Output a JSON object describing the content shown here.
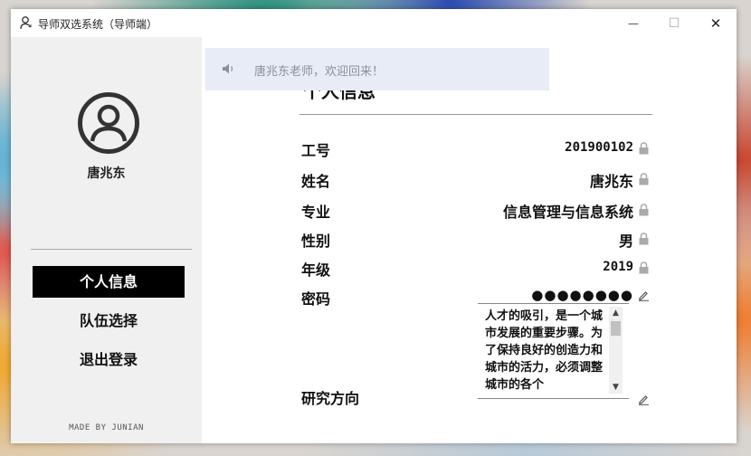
{
  "window": {
    "title": "导师双选系统（导师端）",
    "controls": {
      "minimize": "—",
      "maximize": "☐",
      "close": "✕"
    }
  },
  "sidebar": {
    "user_name": "唐兆东",
    "nav": [
      {
        "label": "个人信息",
        "active": true
      },
      {
        "label": "队伍选择",
        "active": false
      },
      {
        "label": "退出登录",
        "active": false
      }
    ],
    "credit": "MADE BY JUNIAN"
  },
  "notice": {
    "text": "唐兆东老师，欢迎回来！",
    "icon": "speaker-icon"
  },
  "profile": {
    "section_title": "个人信息",
    "rows": [
      {
        "label": "工号",
        "value": "201900102",
        "icon": "lock-icon"
      },
      {
        "label": "姓名",
        "value": "唐兆东",
        "icon": "lock-icon"
      },
      {
        "label": "专业",
        "value": "信息管理与信息系统",
        "icon": "lock-icon"
      },
      {
        "label": "性别",
        "value": "男",
        "icon": "lock-icon"
      },
      {
        "label": "年级",
        "value": "2019",
        "icon": "lock-icon"
      }
    ],
    "password": {
      "label": "密码",
      "value": "●●●●●●●●",
      "icon": "edit-icon"
    },
    "research": {
      "label": "研究方向",
      "value": "人才的吸引，是一个城市发展的重要步骤。为了保持良好的创造力和城市的活力，必须调整城市的各个",
      "icon": "edit-icon"
    }
  },
  "colors": {
    "nav_active_bg": "#000000",
    "notice_bg": "#e8ecf7",
    "notice_text": "#8c8f99"
  }
}
